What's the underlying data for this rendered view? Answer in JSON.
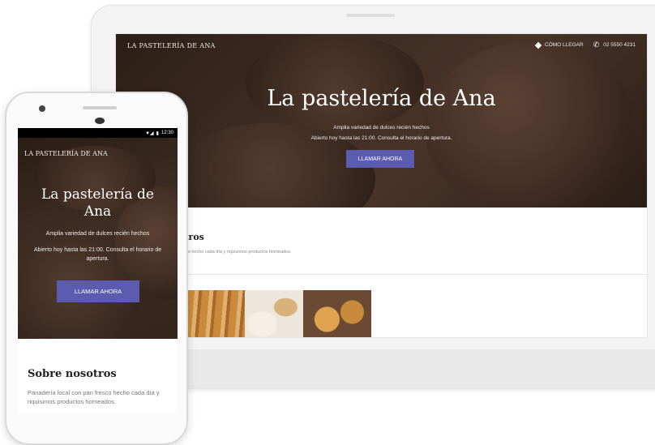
{
  "laptop": {
    "brand": "LA PASTELERÍA DE ANA",
    "nav": {
      "directions": "CÓMO LLEGAR",
      "phone": "02 5550 4231"
    },
    "hero": {
      "title": "La pastelería de Ana",
      "subtitle": "Amplia variedad de dulces recién hechos",
      "hours": "Abierto hoy hasta las 21:00. Consulta el horario de apertura.",
      "cta": "LLAMAR AHORA"
    },
    "about": {
      "title": "Sobre nosotros",
      "text": "Panadería local con pan fresco hecho cada día y riquísimos productos horneados."
    }
  },
  "phone": {
    "status": {
      "time": "12:30"
    },
    "brand": "LA PASTELERÍA DE ANA",
    "hero": {
      "title": "La pastelería de Ana",
      "subtitle": "Amplia variedad de dulces recién hechos",
      "hours": "Abierto hoy hasta las 21:00. Consulta el horario de apertura.",
      "cta": "LLAMAR AHORA"
    },
    "about": {
      "title": "Sobre nosotros",
      "text": "Panadería local con pan fresco hecho cada día y riquísimos productos horneados."
    }
  },
  "colors": {
    "cta": "#5b5bb0",
    "hero_dark": "#3d2b22"
  },
  "icons": [
    "directions-icon",
    "phone-icon",
    "signal-icon",
    "battery-icon"
  ]
}
